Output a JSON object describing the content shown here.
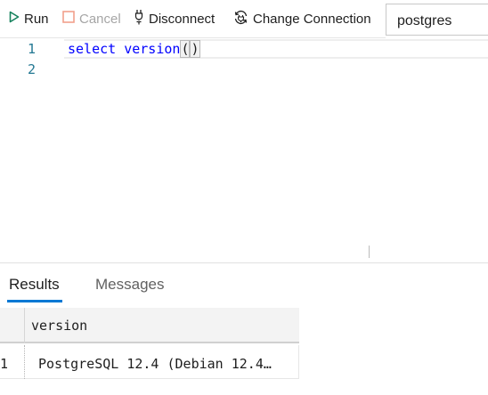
{
  "toolbar": {
    "run_label": "Run",
    "cancel_label": "Cancel",
    "disconnect_label": "Disconnect",
    "change_connection_label": "Change Connection",
    "database_value": "postgres",
    "colors": {
      "run_icon": "#16825d",
      "cancel_icon": "#f1a08c",
      "disabled_text": "#a6a6a6"
    }
  },
  "editor": {
    "lines": [
      {
        "number": "1",
        "keyword": "select",
        "func": "version",
        "open_paren": "(",
        "close_paren": ")"
      },
      {
        "number": "2"
      }
    ],
    "colors": {
      "keyword": "#0000ff",
      "line_number": "#237893"
    }
  },
  "results": {
    "tabs": [
      {
        "label": "Results",
        "active": true
      },
      {
        "label": "Messages",
        "active": false
      }
    ],
    "columns": [
      "version"
    ],
    "rows": [
      {
        "num": "1",
        "cells": [
          "PostgreSQL 12.4 (Debian 12.4…"
        ]
      }
    ],
    "colors": {
      "active_tab_underline": "#0078d4"
    }
  }
}
